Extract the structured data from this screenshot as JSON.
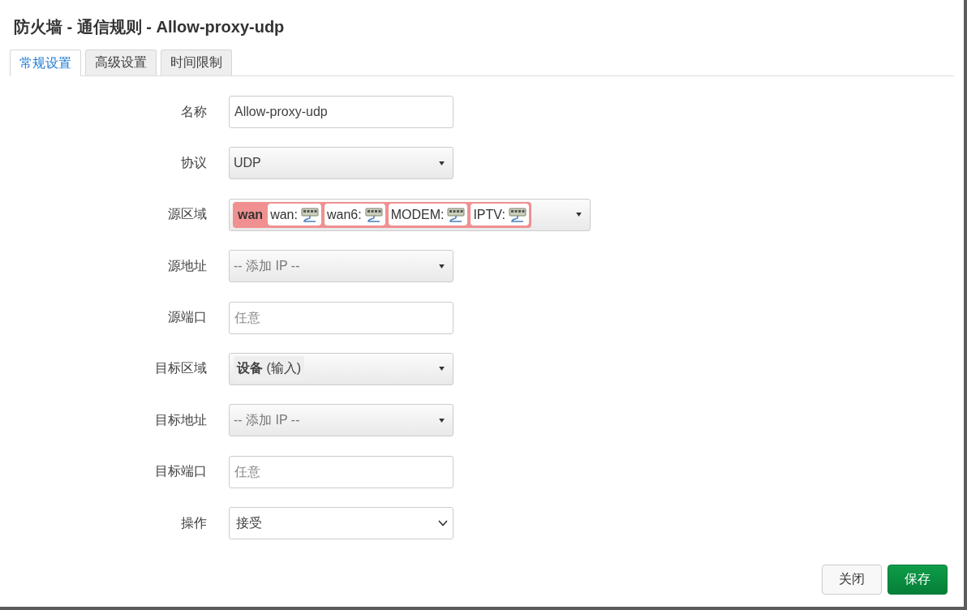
{
  "dialog": {
    "title": "防火墙 - 通信规则 - Allow-proxy-udp"
  },
  "tabs": [
    {
      "label": "常规设置",
      "selected": true
    },
    {
      "label": "高级设置",
      "selected": false
    },
    {
      "label": "时间限制",
      "selected": false
    }
  ],
  "fields": [
    {
      "label": "名称",
      "kind": "text",
      "value": "Allow-proxy-udp"
    },
    {
      "label": "协议",
      "kind": "dropdown",
      "value": "UDP"
    },
    {
      "label": "源区域",
      "kind": "zones",
      "zone": {
        "name": "wan",
        "color": "#f09090",
        "networks": [
          "wan:",
          "wan6:",
          "MODEM:",
          "IPTV:"
        ]
      }
    },
    {
      "label": "源地址",
      "kind": "dropdown",
      "placeholder": "-- 添加 IP --"
    },
    {
      "label": "源端口",
      "kind": "text",
      "placeholder": "任意"
    },
    {
      "label": "目标区域",
      "kind": "zone",
      "zone": {
        "name": "**设备** (输入)",
        "color": "#eeeeee"
      }
    },
    {
      "label": "目标地址",
      "kind": "dropdown",
      "placeholder": "-- 添加 IP --"
    },
    {
      "label": "目标端口",
      "kind": "text",
      "placeholder": "任意"
    },
    {
      "label": "操作",
      "kind": "select",
      "value": "接受"
    }
  ],
  "buttons": [
    {
      "label": "关闭",
      "kind": "secondary"
    },
    {
      "label": "保存",
      "kind": "primary"
    }
  ]
}
